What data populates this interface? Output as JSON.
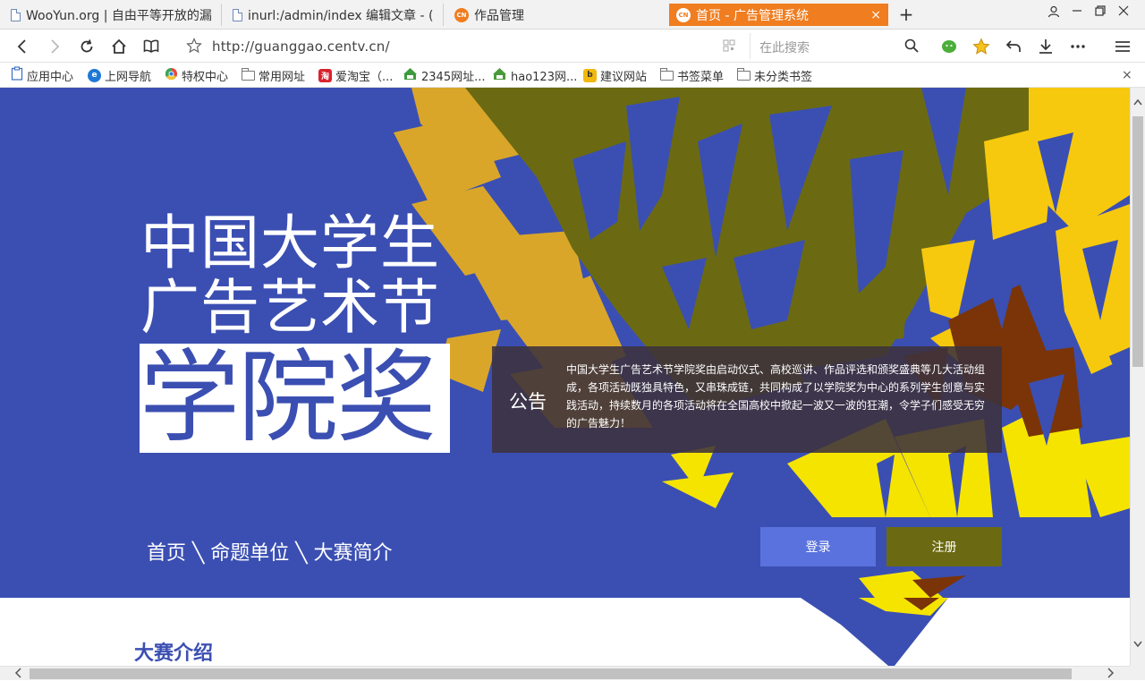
{
  "browser": {
    "tabs": [
      {
        "label": "WooYun.org | 自由平等开放的漏",
        "icon": "page-icon"
      },
      {
        "label": "inurl:/admin/index 编辑文章 - (",
        "icon": "page-icon"
      },
      {
        "label": "作品管理",
        "icon": "cntv-icon"
      },
      {
        "label": "首页 - 广告管理系统",
        "icon": "cntv-icon",
        "active": true
      }
    ],
    "close_glyph": "×",
    "new_tab_glyph": "+",
    "address": "http://guanggao.centv.cn/",
    "search_placeholder": "在此搜索",
    "bookmarks": [
      {
        "label": "应用中心",
        "icon": "clipboard-icon"
      },
      {
        "label": "上网导航",
        "icon": "ie-icon"
      },
      {
        "label": "特权中心",
        "icon": "chrome-icon"
      },
      {
        "label": "常用网址",
        "icon": "folder-icon"
      },
      {
        "label": "爱淘宝（...",
        "icon": "taobao-icon"
      },
      {
        "label": "2345网址...",
        "icon": "2345-icon"
      },
      {
        "label": "hao123网...",
        "icon": "hao123-icon"
      },
      {
        "label": "建议网站",
        "icon": "bing-icon"
      },
      {
        "label": "书签菜单",
        "icon": "folder-icon"
      },
      {
        "label": "未分类书签",
        "icon": "folder-icon"
      }
    ]
  },
  "hero": {
    "title_line1": "中国大学生",
    "title_line2": "广告艺术节",
    "title_line3": "学院奖",
    "notice_label": "公告",
    "notice_text": "中国大学生广告艺术节学院奖由启动仪式、高校巡讲、作品评选和颁奖盛典等几大活动组成，各项活动既独具特色，又串珠成链，共同构成了以学院奖为中心的系列学生创意与实践活动，持续数月的各项活动将在全国高校中掀起一波又一波的狂潮，令学子们感受无穷的广告魅力！",
    "nav": "首页 ╲ 命题单位 ╲ 大赛简介",
    "login_label": "登录",
    "register_label": "注册"
  },
  "section": {
    "title": "大赛介绍"
  },
  "colors": {
    "hero_blue": "#3b4fb2",
    "olive": "#6b6a12",
    "mustard": "#d9a62a",
    "yellow": "#f5e400",
    "brown": "#7a3408",
    "login_blue": "#5a72de",
    "tab_active": "#f07d1f"
  }
}
